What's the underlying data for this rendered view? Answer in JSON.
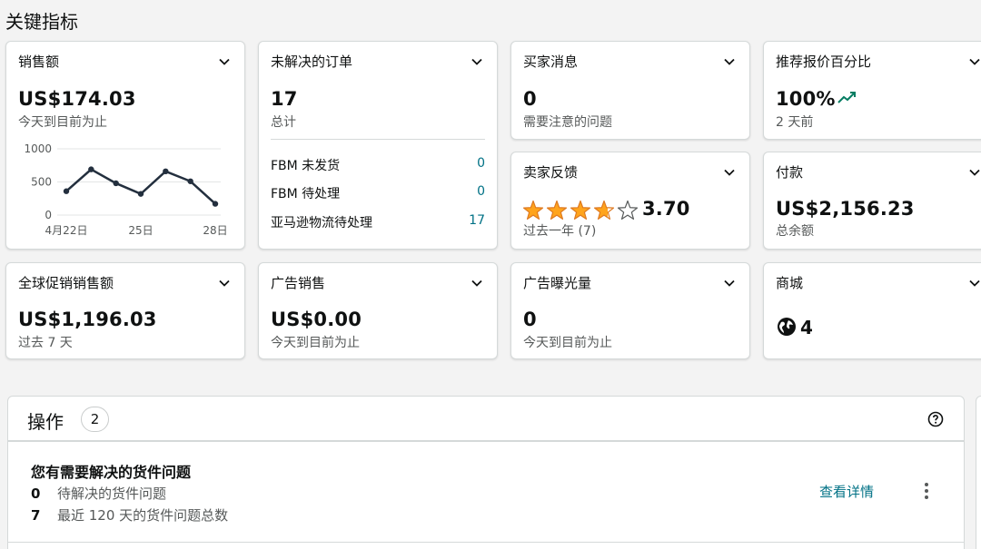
{
  "section_title": "关键指标",
  "cards": {
    "sales": {
      "title": "销售额",
      "value": "US$174.03",
      "sub": "今天到目前为止",
      "chart_data": {
        "type": "line",
        "categories": [
          "4月22日",
          "23日",
          "24日",
          "25日",
          "26日",
          "27日",
          "28日"
        ],
        "x_tick_labels": [
          "4月22日",
          "25日",
          "28日"
        ],
        "values": [
          360,
          690,
          480,
          320,
          660,
          510,
          170
        ],
        "y_ticks": [
          "1000",
          "500",
          "0"
        ],
        "ylim": [
          0,
          1000
        ],
        "grid": true,
        "line_color": "#232f3e"
      }
    },
    "open_orders": {
      "title": "未解决的订单",
      "value": "17",
      "sub": "总计",
      "rows": [
        {
          "label": "FBM 未发货",
          "value": "0"
        },
        {
          "label": "FBM 待处理",
          "value": "0"
        },
        {
          "label": "亚马逊物流待处理",
          "value": "17"
        }
      ]
    },
    "buyer_messages": {
      "title": "买家消息",
      "value": "0",
      "sub": "需要注意的问题"
    },
    "featured_offer": {
      "title": "推荐报价百分比",
      "value": "100%",
      "sub": "2 天前",
      "trend_icon": "trend-up-icon",
      "trend_color": "#067d62"
    },
    "seller_feedback": {
      "title": "卖家反馈",
      "rating": "3.70",
      "rating_value": 3.7,
      "max_rating": 5,
      "star_color": "#ffa41c",
      "sub": "过去一年 (7)"
    },
    "payments": {
      "title": "付款",
      "value": "US$2,156.23",
      "sub": "总余额"
    },
    "global_promo": {
      "title": "全球促销销售额",
      "value": "US$1,196.03",
      "sub": "过去 7 天"
    },
    "ad_sales": {
      "title": "广告销售",
      "value": "US$0.00",
      "sub": "今天到目前为止"
    },
    "ad_impressions": {
      "title": "广告曝光量",
      "value": "0",
      "sub": "今天到目前为止"
    },
    "marketplaces": {
      "title": "商城",
      "value": "4",
      "icon": "globe-icon"
    }
  },
  "actions": {
    "title": "操作",
    "count": "2",
    "help_icon": "help-icon",
    "issue": {
      "title": "您有需要解决的货件问题",
      "lines": [
        {
          "num": "0",
          "text": "待解决的货件问题"
        },
        {
          "num": "7",
          "text": "最近 120 天的货件问题总数"
        }
      ],
      "link": "查看详情"
    }
  },
  "colors": {
    "link": "#007185",
    "text": "#0f1111",
    "muted": "#565959",
    "border": "#d5d9d9"
  }
}
